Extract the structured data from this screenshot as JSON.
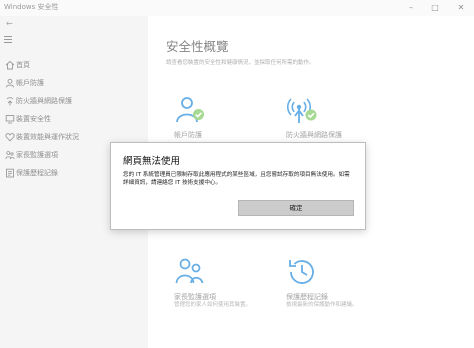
{
  "window": {
    "title": "Windows 安全性",
    "icons": {
      "minimize": "minimize-icon",
      "maximize": "maximize-icon",
      "close": "close-icon"
    }
  },
  "sidebar": {
    "back_icon": "back-arrow-icon",
    "menu_icon": "hamburger-menu-icon",
    "items": [
      {
        "label": "首頁",
        "icon": "home-icon"
      },
      {
        "label": "帳戶防護",
        "icon": "person-icon"
      },
      {
        "label": "防火牆與網路保護",
        "icon": "wifi-antenna-icon"
      },
      {
        "label": "裝置安全性",
        "icon": "device-icon"
      },
      {
        "label": "裝置效能與運作狀況",
        "icon": "heart-icon"
      },
      {
        "label": "家長監護選項",
        "icon": "family-icon"
      },
      {
        "label": "保護歷程記錄",
        "icon": "history-icon"
      }
    ]
  },
  "main": {
    "title": "安全性概覽",
    "subtitle": "請查看您裝置的安全性和健康情況，並採取任何所需的動作。",
    "tiles": [
      {
        "name": "帳戶防護",
        "desc": "",
        "icon": "account-protection-icon"
      },
      {
        "name": "防火牆與網路保護",
        "desc": "",
        "icon": "firewall-network-icon"
      },
      {
        "name": "家長監護選項",
        "desc": "管理您的家人如何使用其裝置。",
        "icon": "family-options-icon"
      },
      {
        "name": "保護歷程記錄",
        "desc": "檢視最新的保護動作和建議。",
        "icon": "protection-history-icon"
      }
    ]
  },
  "dialog": {
    "title": "網頁無法使用",
    "message": "您的 IT 系統管理員已限制存取此應用程式的某些區域，且您嘗試存取的項目無法使用。如需詳細資訊，請連絡您 IT 技術支援中心。",
    "ok_label": "確定"
  },
  "colors": {
    "accent": "#0078d4",
    "check_green": "#6cc04a",
    "sidebar_bg": "#efefef",
    "button_bg": "#cccccc"
  }
}
